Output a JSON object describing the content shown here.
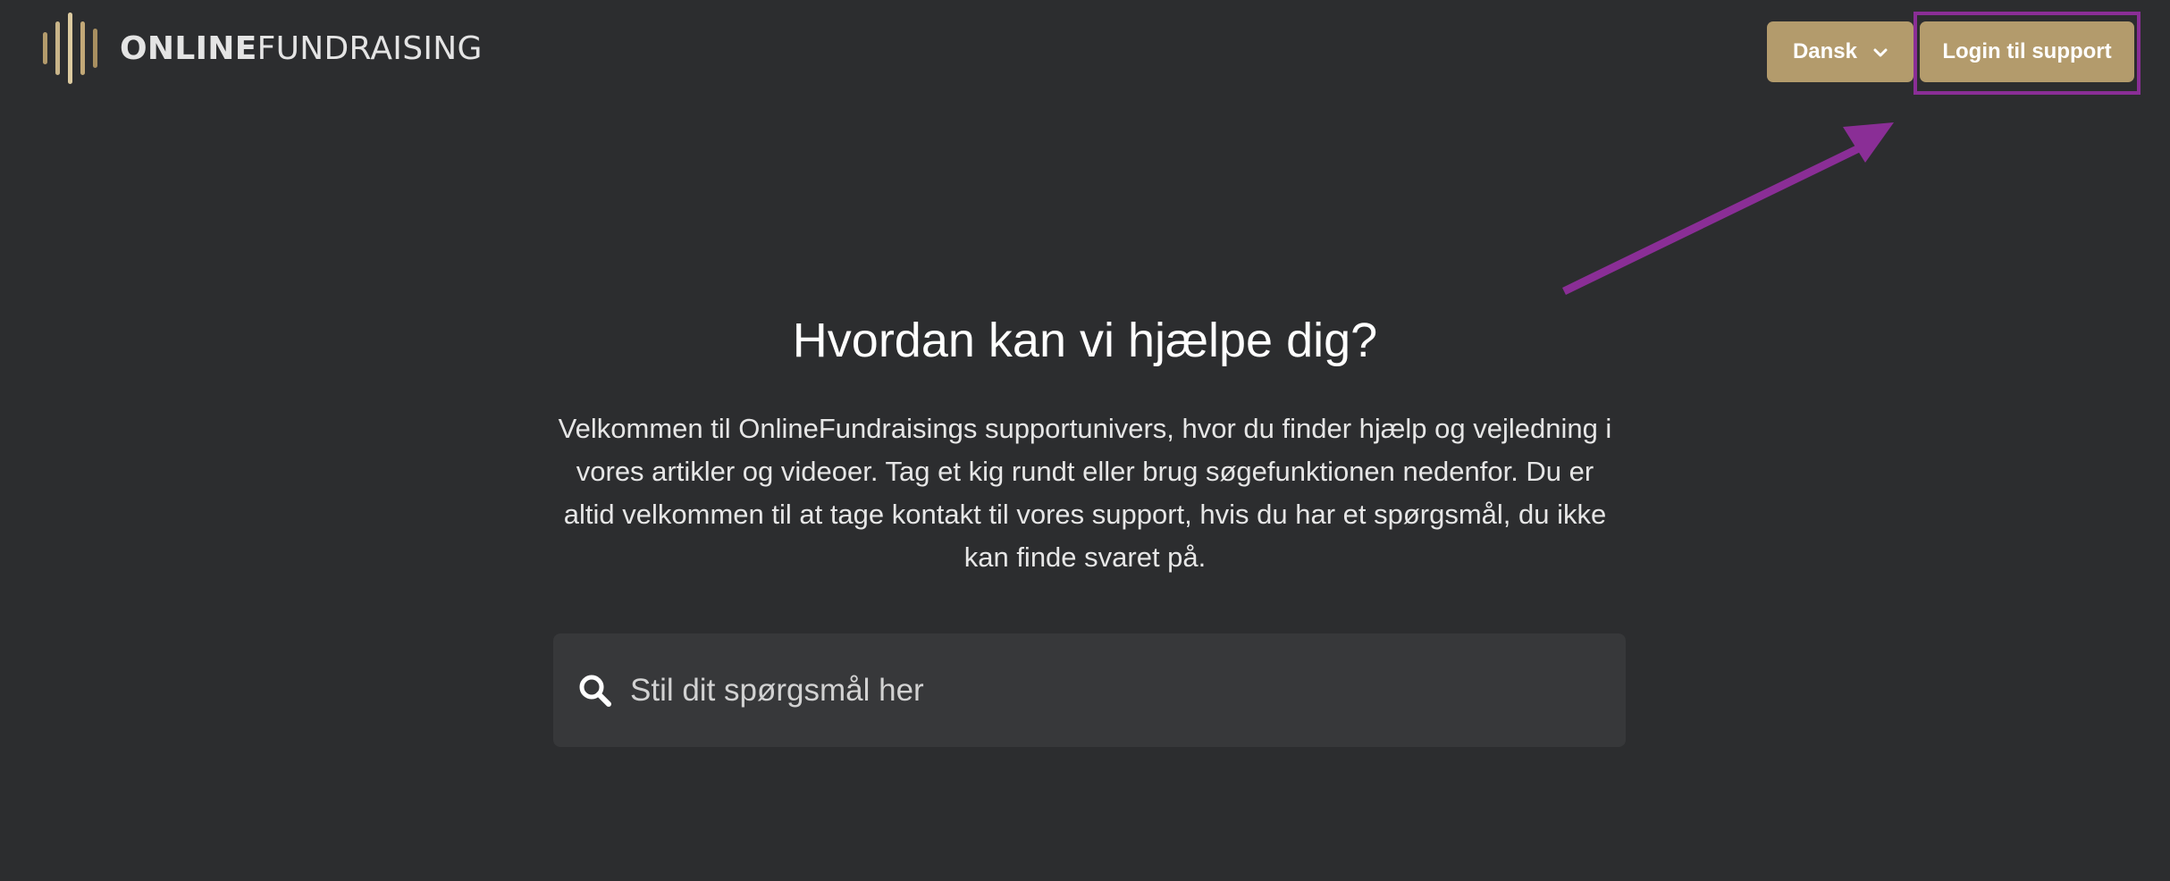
{
  "brand": {
    "logo_bold": "ONLINE",
    "logo_regular": "FUNDRAISING",
    "accent": "#b39b6c"
  },
  "header": {
    "language_label": "Dansk",
    "login_label": "Login til support"
  },
  "hero": {
    "title": "Hvordan kan vi hjælpe dig?",
    "intro": "Velkommen til OnlineFundraisings supportunivers, hvor du finder hjælp og vejledning i vores artikler og videoer. Tag et kig rundt eller brug søgefunktionen nedenfor. Du er altid velkommen til at tage kontakt til vores support, hvis du har et spørgsmål, du ikke kan finde svaret på."
  },
  "search": {
    "placeholder": "Stil dit spørgsmål her",
    "value": ""
  },
  "annotation": {
    "color": "#8a2e96"
  },
  "colors": {
    "background": "#2c2d2f",
    "search_bg": "#37383a"
  },
  "icons": {
    "search": "search-icon",
    "chevron": "chevron-down-icon"
  }
}
